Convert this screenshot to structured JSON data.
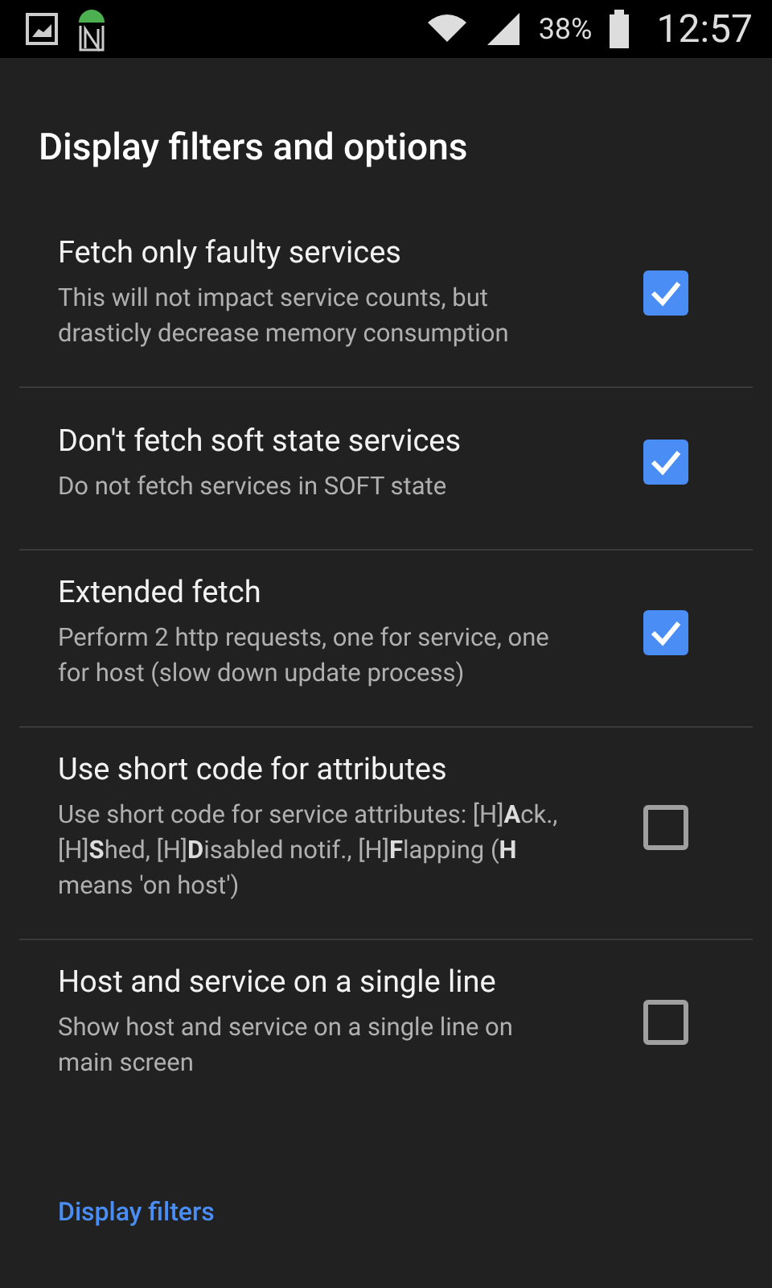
{
  "status_bar": {
    "battery": "38%",
    "time": "12:57"
  },
  "title": "Display filters and options",
  "options": [
    {
      "title": "Fetch only faulty services",
      "summary": "This will not impact service counts, but drasticly decrease memory consumption",
      "checked": true
    },
    {
      "title": "Don't fetch soft state services",
      "summary": "Do not fetch services in SOFT state",
      "checked": true
    },
    {
      "title": "Extended fetch",
      "summary": "Perform 2 http requests, one for service, one for host (slow down update process)",
      "checked": true
    },
    {
      "title": "Use short code for attributes",
      "summary": "Use short code for service attributes: [H]**A**ck., [H]**S**hed, [H]**D**isabled notif., [H]**F**lapping (**H** means 'on host')",
      "checked": false
    },
    {
      "title": "Host and service on a single line",
      "summary": "Show host and service on a single line on main screen",
      "checked": false
    }
  ],
  "section_header": "Display filters"
}
